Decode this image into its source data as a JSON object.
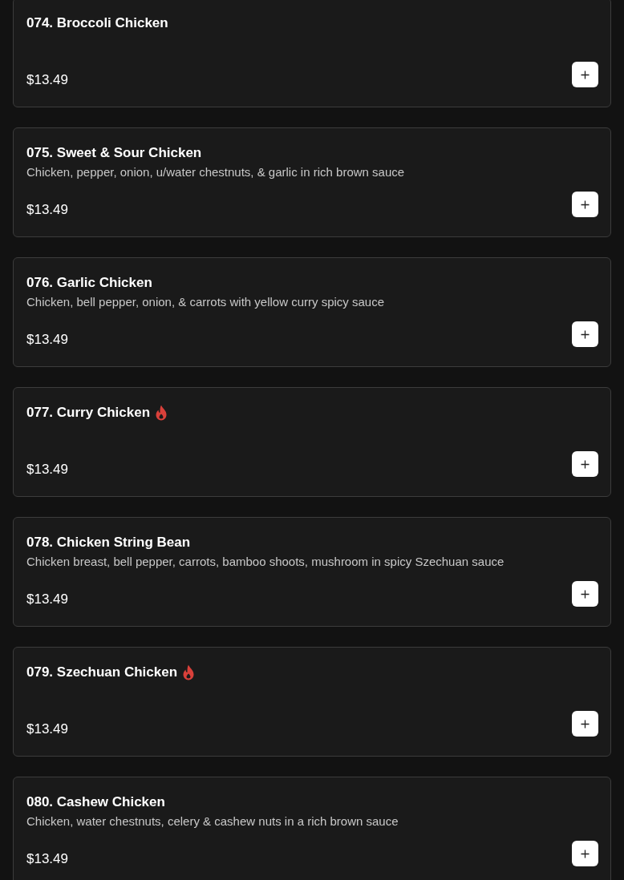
{
  "items": [
    {
      "name": "074. Broccoli Chicken",
      "spicy": false,
      "price": "$13.49"
    },
    {
      "name": "075. Sweet & Sour Chicken",
      "description": "Chicken, pepper, onion, u/water chestnuts, & garlic in rich brown sauce",
      "spicy": false,
      "price": "$13.49"
    },
    {
      "name": "076. Garlic Chicken",
      "description": "Chicken, bell pepper, onion, & carrots with yellow curry spicy sauce",
      "spicy": false,
      "price": "$13.49"
    },
    {
      "name": "077. Curry Chicken",
      "spicy": true,
      "price": "$13.49"
    },
    {
      "name": "078. Chicken String Bean",
      "description": "Chicken breast, bell pepper, carrots, bamboo shoots, mushroom in spicy Szechuan sauce",
      "spicy": false,
      "price": "$13.49"
    },
    {
      "name": "079. Szechuan Chicken",
      "spicy": true,
      "price": "$13.49"
    },
    {
      "name": "080. Cashew Chicken",
      "description": "Chicken, water chestnuts, celery & cashew nuts in a rich brown sauce",
      "spicy": false,
      "price": "$13.49"
    }
  ]
}
